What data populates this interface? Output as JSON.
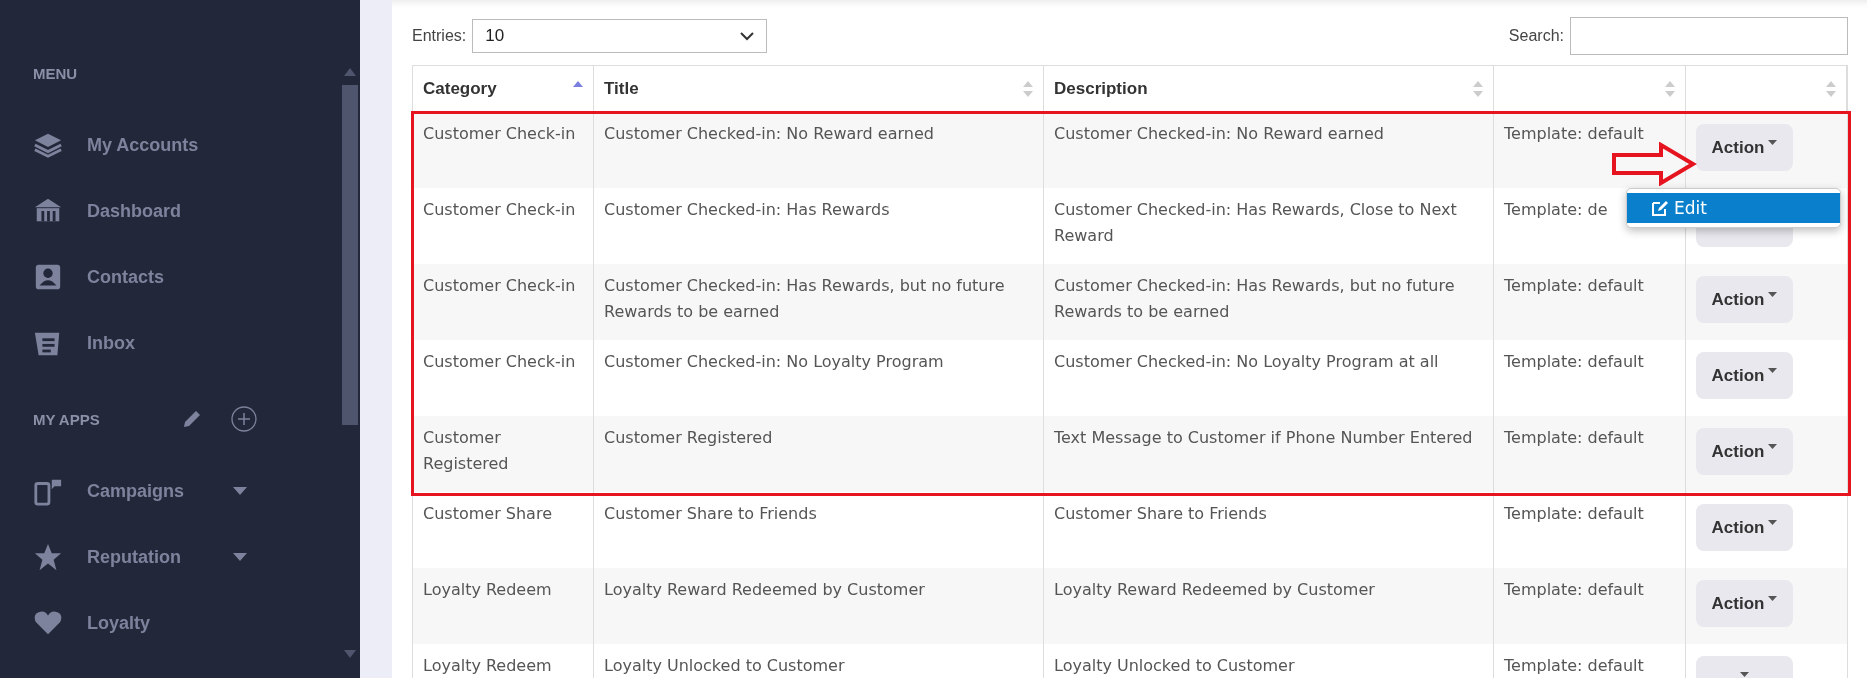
{
  "sidebar": {
    "sections": [
      {
        "title": "MENU",
        "tools": false,
        "items": [
          {
            "label": "My Accounts",
            "expandable": false
          },
          {
            "label": "Dashboard",
            "expandable": false
          },
          {
            "label": "Contacts",
            "expandable": false
          },
          {
            "label": "Inbox",
            "expandable": false
          }
        ]
      },
      {
        "title": "MY APPS",
        "tools": true,
        "items": [
          {
            "label": "Campaigns",
            "expandable": true
          },
          {
            "label": "Reputation",
            "expandable": true
          },
          {
            "label": "Loyalty",
            "expandable": false
          }
        ]
      }
    ]
  },
  "entries": {
    "label": "Entries:",
    "value": "10"
  },
  "search": {
    "label": "Search:"
  },
  "table": {
    "columns": [
      {
        "label": "Category",
        "sorted": true
      },
      {
        "label": "Title",
        "sorted": false
      },
      {
        "label": "Description",
        "sorted": false
      },
      {
        "sorted": false
      },
      {
        "sorted": false
      }
    ],
    "rows": [
      {
        "highlighted": true,
        "cells": [
          "Customer Check-in",
          "Customer Checked-in: No Reward earned",
          "Customer Checked-in: No Reward earned",
          "Template: default"
        ],
        "action": "Action",
        "menu": {
          "items": [
            {
              "label": "Edit",
              "selected": true
            }
          ]
        }
      },
      {
        "highlighted": true,
        "cells": [
          "Customer Check-in",
          "Customer Checked-in: Has Rewards",
          "Customer Checked-in: Has Rewards, Close to Next Reward",
          "Template: de"
        ]
      },
      {
        "highlighted": true,
        "cells": [
          "Customer Check-in",
          "Customer Checked-in: Has Rewards, but no future Rewards to be earned",
          "Customer Checked-in: Has Rewards, but no future Rewards to be earned",
          "Template: default"
        ],
        "action": "Action"
      },
      {
        "highlighted": true,
        "cells": [
          "Customer Check-in",
          "Customer Checked-in: No Loyalty Program",
          "Customer Checked-in: No Loyalty Program at all",
          "Template: default"
        ],
        "action": "Action"
      },
      {
        "highlighted": true,
        "cells": [
          "Customer Registered",
          "Customer Registered",
          "Text Message to Customer if Phone Number Entered",
          "Template: default"
        ],
        "action": "Action"
      },
      {
        "highlighted": false,
        "cells": [
          "Customer Share",
          "Customer Share to Friends",
          "Customer Share to Friends",
          "Template: default"
        ],
        "action": "Action"
      },
      {
        "highlighted": false,
        "cells": [
          "Loyalty Redeem",
          "Loyalty Reward Redeemed by Customer",
          "Loyalty Reward Redeemed by Customer",
          "Template: default"
        ],
        "action": "Action"
      },
      {
        "highlighted": false,
        "cells": [
          "Loyalty Redeem",
          "Loyalty Unlocked to Customer",
          "Loyalty Unlocked to Customer",
          "Template: default"
        ]
      }
    ]
  }
}
